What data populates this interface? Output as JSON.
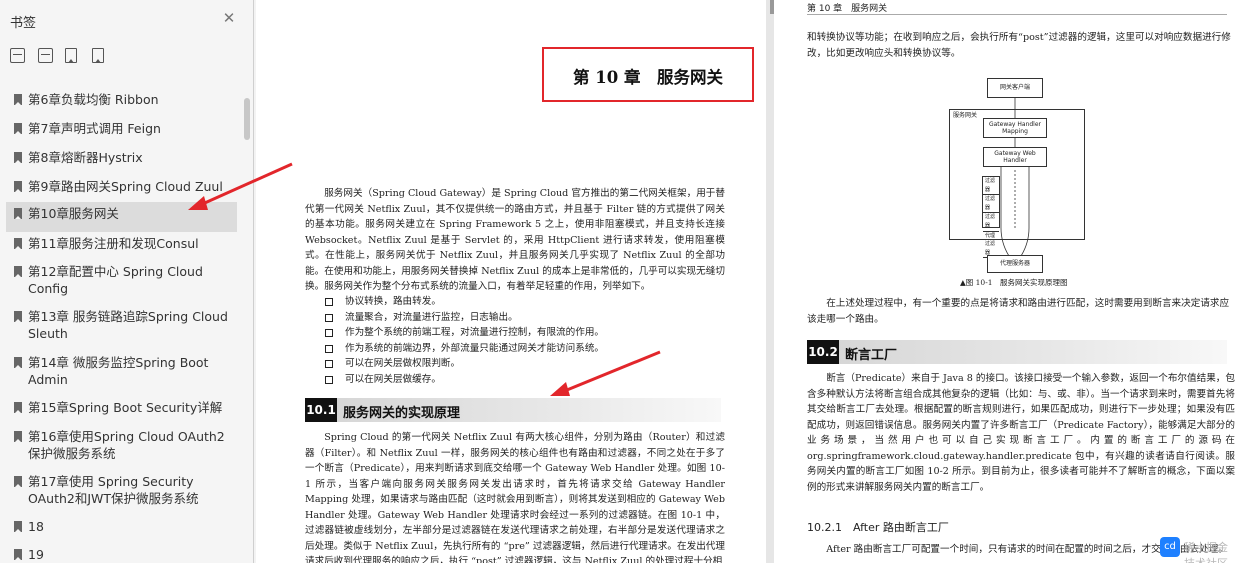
{
  "sidebar": {
    "title": "书签",
    "close_icon": "close-icon",
    "toolbar": [
      "expand-all-icon",
      "collapse-all-icon",
      "add-bookmark-icon",
      "bookmark-icon"
    ],
    "items": [
      {
        "label": "第6章负载均衡 Ribbon",
        "active": false
      },
      {
        "label": "第7章声明式调用 Feign",
        "active": false
      },
      {
        "label": "第8章熔断器Hystrix",
        "active": false
      },
      {
        "label": "第9章路由网关Spring Cloud Zuul",
        "active": false
      },
      {
        "label": "第10章服务网关",
        "active": true
      },
      {
        "label": "第11章服务注册和发现Consul",
        "active": false
      },
      {
        "label": "第12章配置中心 Spring Cloud Config",
        "active": false
      },
      {
        "label": "第13章 服务链路追踪Spring Cloud Sleuth",
        "active": false
      },
      {
        "label": "第14章 微服务监控Spring Boot Admin",
        "active": false
      },
      {
        "label": "第15章Spring Boot Security详解",
        "active": false
      },
      {
        "label": "第16章使用Spring Cloud OAuth2保护微服务系统",
        "active": false
      },
      {
        "label": "第17章使用 Spring Security OAuth2和JWT保护微服务系统",
        "active": false
      },
      {
        "label": "18",
        "active": false
      },
      {
        "label": "19",
        "active": false
      }
    ]
  },
  "left_page": {
    "chapter_title": "第 10 章　服务网关",
    "intro": "服务网关（Spring Cloud Gateway）是 Spring Cloud 官方推出的第二代网关框架，用于替代第一代网关 Netflix Zuul，其不仅提供统一的路由方式，并且基于 Filter 链的方式提供了网关的基本功能。服务网关建立在 Spring Framework 5 之上，使用非阻塞模式，并且支持长连接 Websocket。Netflix Zuul 是基于 Servlet 的，采用 HttpClient 进行请求转发，使用阻塞模式。在性能上，服务网关优于 Netflix Zuul，并且服务网关几乎实现了 Netflix Zuul 的全部功能。在使用和功能上，用服务网关替换掉 Netflix Zuul 的成本上是非常低的，几乎可以实现无缝切换。",
    "intro2": "服务网关作为整个分布式系统的流量入口，有着举足轻重的作用，列举如下。",
    "bullets": [
      "协议转换，路由转发。",
      "流量聚合，对流量进行监控，日志输出。",
      "作为整个系统的前端工程，对流量进行控制，有限流的作用。",
      "作为系统的前端边界，外部流量只能通过网关才能访问系统。",
      "可以在网关层做权限判断。",
      "可以在网关层做缓存。"
    ],
    "section_num": "10.1",
    "section_title": "服务网关的实现原理",
    "section_text": "Spring Cloud 的第一代网关 Netflix Zuul 有两大核心组件，分别为路由（Router）和过滤器（Filter）。和 Netflix Zuul 一样，服务网关的核心组件也有路由和过滤器，不同之处在于多了一个断言（Predicate），用来判断请求到底交给哪一个 Gateway Web Handler 处理。如图 10-1 所示，当客户端向服务网关服务网关发出请求时，首先将请求交给 Gateway Handler Mapping 处理，如果请求与路由匹配（这时就会用到断言），则将其发送到相应的 Gateway Web Handler 处理。Gateway Web Handler 处理请求时会经过一系列的过滤器链。在图 10-1 中，过滤器链被虚线划分，左半部分是过滤器链在发送代理请求之前处理，右半部分是发送代理请求之后处理。类似于 Netflix Zuul，先执行所有的 “pre” 过滤器逻辑，然后进行代理请求。在发出代理请求后收到代理服务的响应之后，执行 “post” 过滤器逻辑，这与 Netflix Zuul 的处理过程十分相"
  },
  "right_page": {
    "running_head": "第 10 章　服务网关",
    "p1": "和转换协议等功能；在收到响应之后，会执行所有“post”过滤器的逻辑，这里可以对响应数据进行修改，比如更改响应头和转换协议等。",
    "diagram": {
      "client": "网关客户端",
      "outer": "服务网关",
      "mapping": "Gateway Handler Mapping",
      "web_handler": "Gateway Web Handler",
      "filters": [
        "过滤器",
        "过滤器",
        "过滤器",
        "代理过滤器"
      ],
      "proxied": "代理服务器"
    },
    "figure_caption": "▲图 10-1　服务网关实现原理图",
    "p2": "在上述处理过程中，有一个重要的点是将请求和路由进行匹配，这时需要用到断言来决定请求应该走哪一个路由。",
    "section_num": "10.2",
    "section_title": "断言工厂",
    "p3": "断言（Predicate）来自于 Java 8 的接口。该接口接受一个输入参数，返回一个布尔值结果，包含多种默认方法将断言组合成其他复杂的逻辑（比如：与、或、非）。当一个请求到来时，需要首先将其交给断言工厂去处理。根据配置的断言规则进行，如果匹配成功，则进行下一步处理；如果没有匹配成功，则返回错误信息。服务网关内置了许多断言工厂（Predicate Factory），能够满足大部分的业务场景，当然用户也可以自己实现断言工厂。内置的断言工厂的源码在 org.springframework.cloud.gateway.handler.predicate 包中，有兴趣的读者请自行阅读。服务网关内置的断言工厂如图 10-2 所示。到目前为止，很多读者可能并不了解断言的概念，下面以案例的形式来讲解服务网关内置的断言工厂。",
    "subheading": "10.2.1　After 路由断言工厂",
    "p4": "After 路由断言工厂可配置一个时间，只有请求的时间在配置的时间之后，才交给路由去处理。"
  },
  "watermark": {
    "text": "稀土掘金技术社区",
    "logo": "cd"
  },
  "colors": {
    "annotation": "#e2262b",
    "active_item": "#dcdcdc",
    "watermark_logo": "#1e80ff"
  }
}
